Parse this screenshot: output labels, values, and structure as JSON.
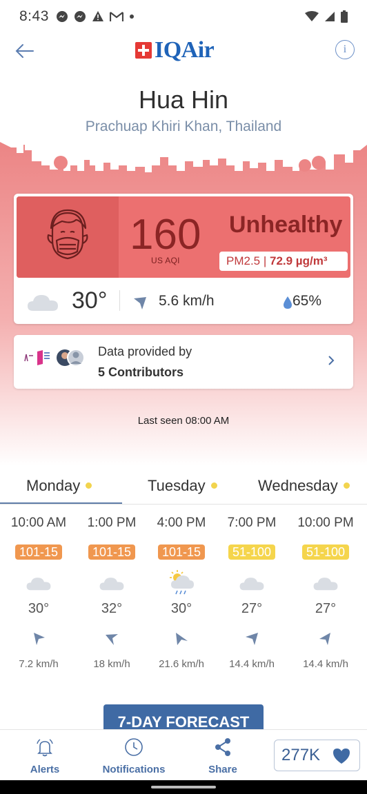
{
  "status_bar": {
    "time": "8:43"
  },
  "header": {
    "logo_text": "IQAir",
    "city": "Hua Hin",
    "region": "Prachuap Khiri Khan, Thailand"
  },
  "aqi_card": {
    "aqi": "160",
    "unit": "US AQI",
    "status": "Unhealthy",
    "pollutant": "PM2.5 | ",
    "concentration": "72.9 µg/m³",
    "temperature": "30°",
    "wind": "5.6 km/h",
    "humidity": "65%",
    "color": "#ec7070"
  },
  "contributors": {
    "line1": "Data provided by",
    "line2": "5 Contributors"
  },
  "last_seen": "Last seen 08:00 AM",
  "tabs": [
    {
      "label": "Monday"
    },
    {
      "label": "Tuesday"
    },
    {
      "label": "Wednesday"
    }
  ],
  "hourly": [
    {
      "time": "10:00 AM",
      "aqi": "101-15",
      "aqi_color": "#f0974f",
      "icon": "cloud-icon",
      "temp": "30°",
      "wind": "7.2 km/h"
    },
    {
      "time": "1:00 PM",
      "aqi": "101-15",
      "aqi_color": "#f0974f",
      "icon": "cloud-icon",
      "temp": "32°",
      "wind": "18 km/h"
    },
    {
      "time": "4:00 PM",
      "aqi": "101-15",
      "aqi_color": "#f0974f",
      "icon": "sun-rain-icon",
      "temp": "30°",
      "wind": "21.6 km/h"
    },
    {
      "time": "7:00 PM",
      "aqi": "51-100",
      "aqi_color": "#f5d54c",
      "icon": "cloud-icon",
      "temp": "27°",
      "wind": "14.4 km/h"
    },
    {
      "time": "10:00 PM",
      "aqi": "51-100",
      "aqi_color": "#f5d54c",
      "icon": "cloud-icon",
      "temp": "27°",
      "wind": "14.4 km/h"
    }
  ],
  "forecast_button": "7-DAY FORECAST",
  "bottom_nav": {
    "alerts": "Alerts",
    "notifications": "Notifications",
    "share": "Share",
    "likes": "277K"
  }
}
